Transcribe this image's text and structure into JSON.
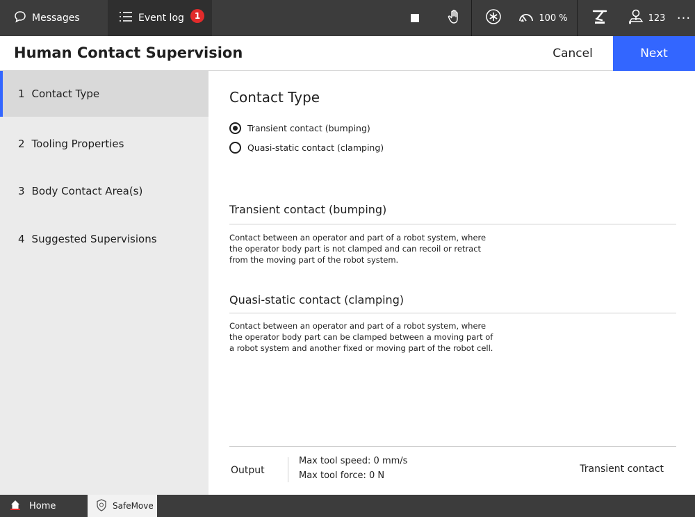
{
  "topbar": {
    "messages_label": "Messages",
    "eventlog_label": "Event log",
    "eventlog_badge": "1",
    "speed_value": "100 %",
    "jog_value": "123",
    "more_glyph": "···",
    "icons": {
      "messages": "chat-icon",
      "eventlog": "list-icon",
      "stop": "stop-icon",
      "hand": "hand-icon",
      "run": "run-mode-icon",
      "speed": "speedometer-icon",
      "robot": "robot-icon",
      "jog": "joystick-icon"
    }
  },
  "header": {
    "title": "Human Contact Supervision",
    "cancel_label": "Cancel",
    "next_label": "Next",
    "accent_color": "#3366ff"
  },
  "sidebar": {
    "steps": [
      {
        "num": "1",
        "label": "Contact Type",
        "active": true
      },
      {
        "num": "2",
        "label": "Tooling Properties",
        "active": false
      },
      {
        "num": "3",
        "label": "Body Contact Area(s)",
        "active": false
      },
      {
        "num": "4",
        "label": "Suggested Supervisions",
        "active": false
      }
    ]
  },
  "main": {
    "title": "Contact Type",
    "options": [
      {
        "label": "Transient contact (bumping)",
        "checked": true
      },
      {
        "label": "Quasi-static contact (clamping)",
        "checked": false
      }
    ],
    "descriptions": [
      {
        "title": "Transient contact (bumping)",
        "lines": [
          "Contact between an operator and part of a robot system, where",
          "the operator body part is not clamped and can recoil or retract",
          "from the moving part of the robot system."
        ]
      },
      {
        "title": "Quasi-static contact (clamping)",
        "lines": [
          "Contact between an operator and part of a robot system, where",
          "the operator body part can be clamped between a moving part of",
          "a robot system and another fixed or moving part of the robot cell."
        ]
      }
    ],
    "output": {
      "label": "Output",
      "speed": "Max tool speed: 0 mm/s",
      "force": "Max tool force:  0 N",
      "type": "Transient contact"
    }
  },
  "taskbar": {
    "home_label": "Home",
    "safemove_label": "SafeMove",
    "home_icon": "home-icon",
    "safemove_icon": "shield-icon"
  }
}
